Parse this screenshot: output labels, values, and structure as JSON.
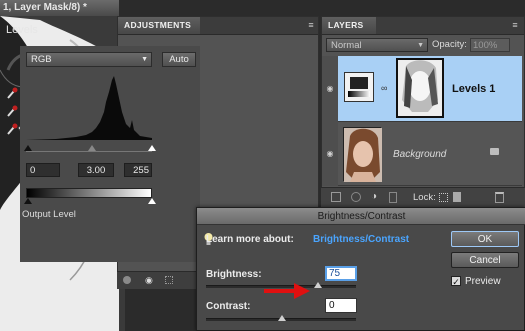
{
  "document": {
    "tab_title": "1, Layer Mask/8) *"
  },
  "adjustments": {
    "tab_label": "ADJUSTMENTS",
    "title": "Levels",
    "channel": "RGB",
    "auto_label": "Auto",
    "input_black": "0",
    "input_gamma": "3.00",
    "input_white": "255",
    "output_label": "Output Level"
  },
  "layers": {
    "tab_label": "LAYERS",
    "blend_mode": "Normal",
    "opacity_label": "Opacity:",
    "opacity_value": "100%",
    "lock_label": "Lock:",
    "items": [
      {
        "name": "Levels 1"
      },
      {
        "name": "Background"
      }
    ]
  },
  "dialog": {
    "title": "Brightness/Contrast",
    "learn_prefix": "Learn more about:",
    "learn_link": "Brightness/Contrast",
    "ok_label": "OK",
    "cancel_label": "Cancel",
    "preview_label": "Preview",
    "preview_checked": true,
    "brightness_label": "Brightness:",
    "brightness_value": "75",
    "contrast_label": "Contrast:",
    "contrast_value": "0"
  },
  "colors": {
    "selection_blue": "#a9d0f5",
    "link_blue": "#4aa5ff",
    "annotation_red": "#e01010"
  }
}
